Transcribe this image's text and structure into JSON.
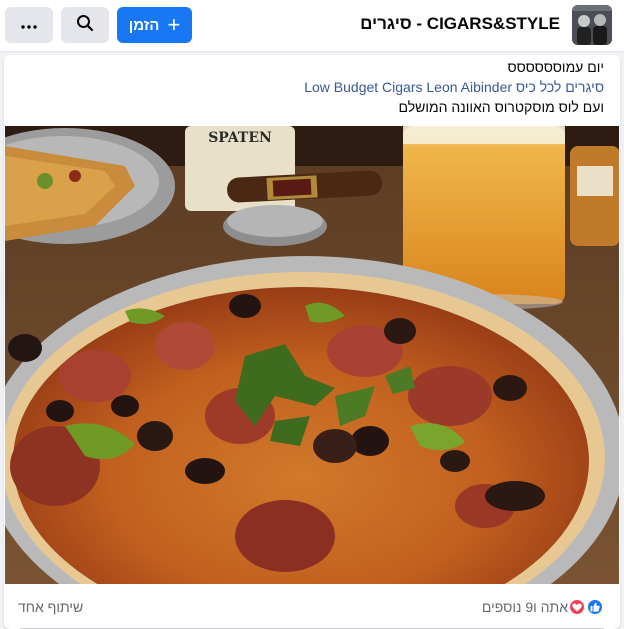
{
  "header": {
    "group_name": "סיגרים - CIGARS&STYLE",
    "join_label": "הזמן",
    "join_icon": "plus-icon",
    "search_icon": "search-icon",
    "more_icon": "more-icon"
  },
  "post": {
    "lines": [
      "יום עמוסססססס",
      "סיגרים לכל כיס Low Budget Cigars Leon Aibinder",
      "ועם לוס מוסקטרוס האוונה המושלם"
    ],
    "photo": {
      "label": "SPATEN"
    }
  },
  "footer": {
    "reactions_text": "אתה ו9 נוספים",
    "shares_text": "שיתוף אחד"
  },
  "colors": {
    "brand": "#1877f2",
    "link": "#385898",
    "love": "#f33e58"
  }
}
